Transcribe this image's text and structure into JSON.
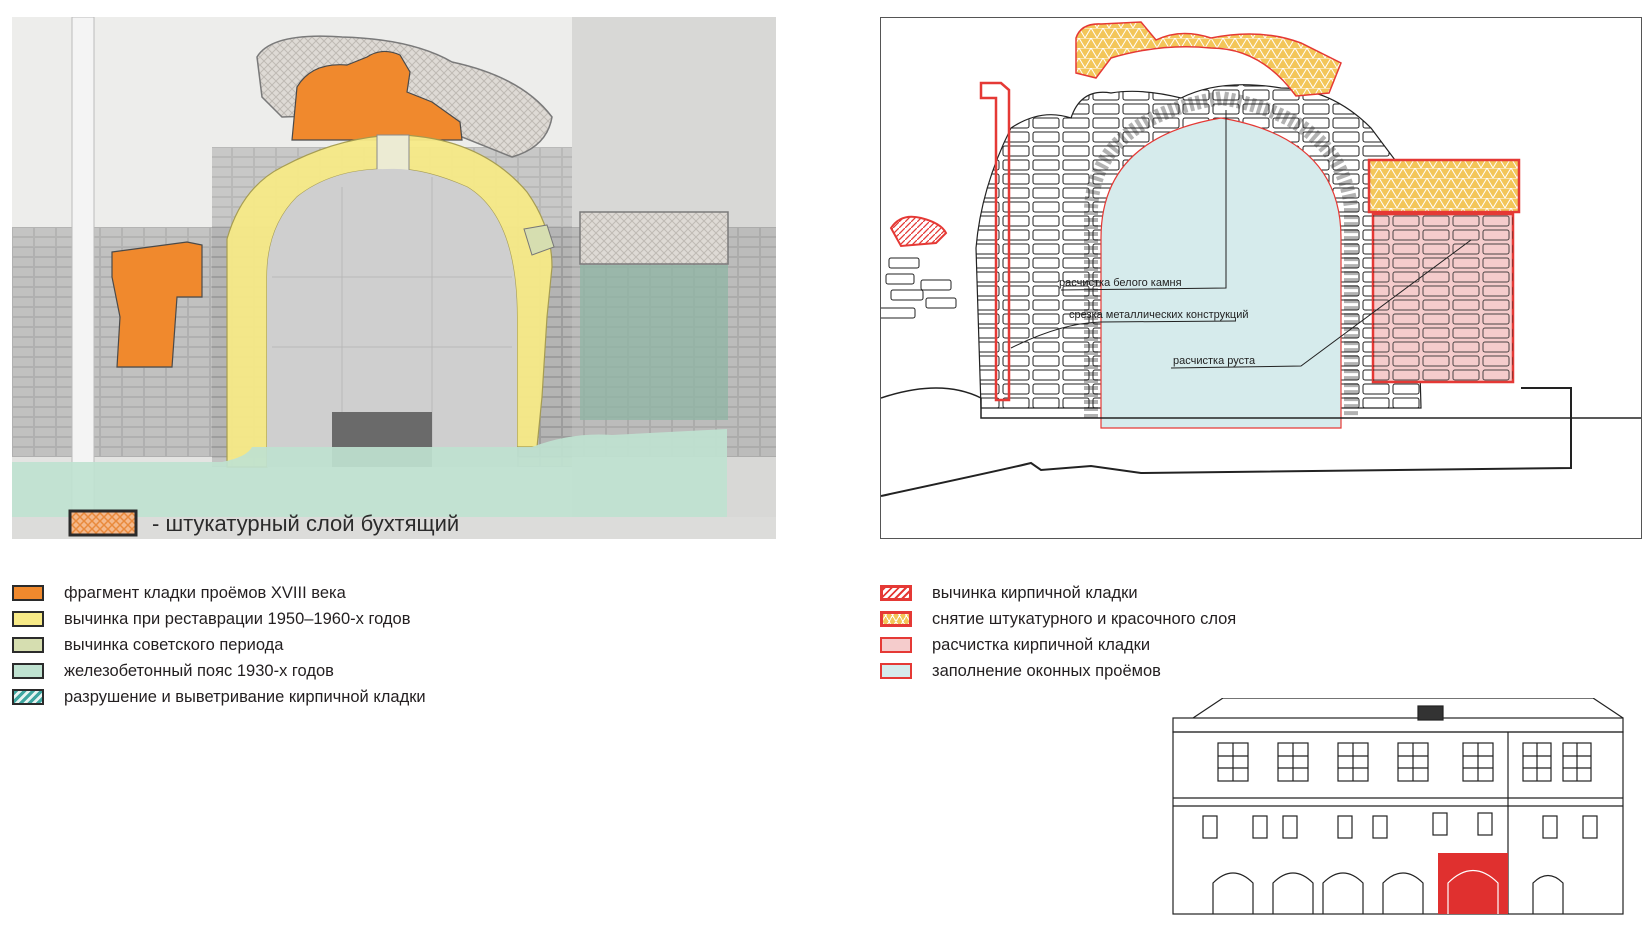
{
  "photo": {
    "inset_legend_label": "- штукатурный слой бухтящий"
  },
  "drawing": {
    "annotations": [
      "расчистка белого камня",
      "срезка металлических конструкций",
      "расчистка руста"
    ]
  },
  "legend_left": [
    {
      "label": "фрагмент кладки проёмов XVIII века",
      "color": "#f0892d",
      "icon": "solid-swatch"
    },
    {
      "label": "вычинка при реставрации 1950–1960-х годов",
      "color": "#f7ea87",
      "icon": "solid-swatch"
    },
    {
      "label": "вычинка советского периода",
      "color": "#d6deb0",
      "icon": "solid-swatch"
    },
    {
      "label": "железобетонный пояс 1930-х годов",
      "color": "#bfe2d0",
      "icon": "solid-swatch"
    },
    {
      "label": "разрушение и выветривание кирпичной кладки",
      "color": "#3ea6a0",
      "icon": "hatch-swatch"
    }
  ],
  "legend_right": [
    {
      "label": "вычинка кирпичной кладки",
      "color": "#e53935",
      "icon": "red-hatch-swatch"
    },
    {
      "label": "снятие штукатурного и красочного слоя",
      "color": "#f3c659",
      "icon": "triangle-pattern-swatch"
    },
    {
      "label": "расчистка кирпичной кладки",
      "color": "#f5cccc",
      "icon": "solid-swatch"
    },
    {
      "label": "заполнение оконных проёмов",
      "color": "#d6ebec",
      "icon": "solid-swatch"
    }
  ]
}
